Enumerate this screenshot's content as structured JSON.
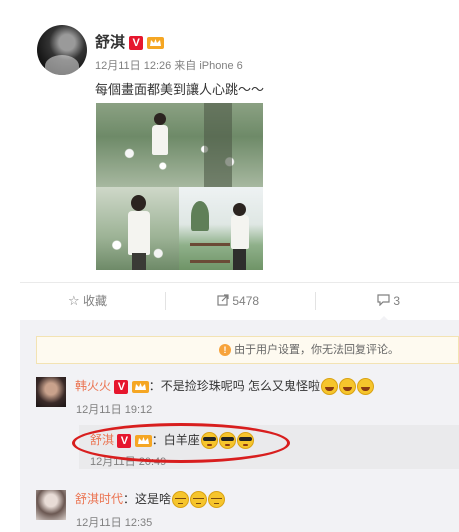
{
  "post": {
    "author": "舒淇",
    "verified_badge": "V",
    "meta": "12月11日 12:26 来自 iPhone 6",
    "text": "每個畫面都美到讓人心跳～～",
    "image_icons": [
      "photo-collage"
    ]
  },
  "actions": {
    "favorite_label": "收藏",
    "repost_count": "5478",
    "comment_count": "3"
  },
  "notice": {
    "text": "由于用户设置，你无法回复评论。"
  },
  "comments": [
    {
      "name": "韩火火",
      "badge": "V",
      "text": "：不是捡珍珠呢吗 怎么又鬼怪啦",
      "time": "12月11日 19:12",
      "emoji": [
        "laugh",
        "laugh",
        "laugh"
      ]
    },
    {
      "name": "舒淇时代",
      "text": "：这是啥",
      "time": "12月11日 12:35",
      "emoji": [
        "shy",
        "shy",
        "shy"
      ]
    }
  ],
  "reply": {
    "name": "舒淇",
    "badge": "V",
    "text": "：白羊座",
    "time": "12月11日 20:49",
    "emoji": [
      "cool",
      "cool",
      "cool"
    ]
  },
  "colors": {
    "name_link": "#eb7350",
    "verified_red": "#e6162d",
    "annotation_red": "#d81e1e",
    "panel_bg": "#f2f2f5"
  }
}
